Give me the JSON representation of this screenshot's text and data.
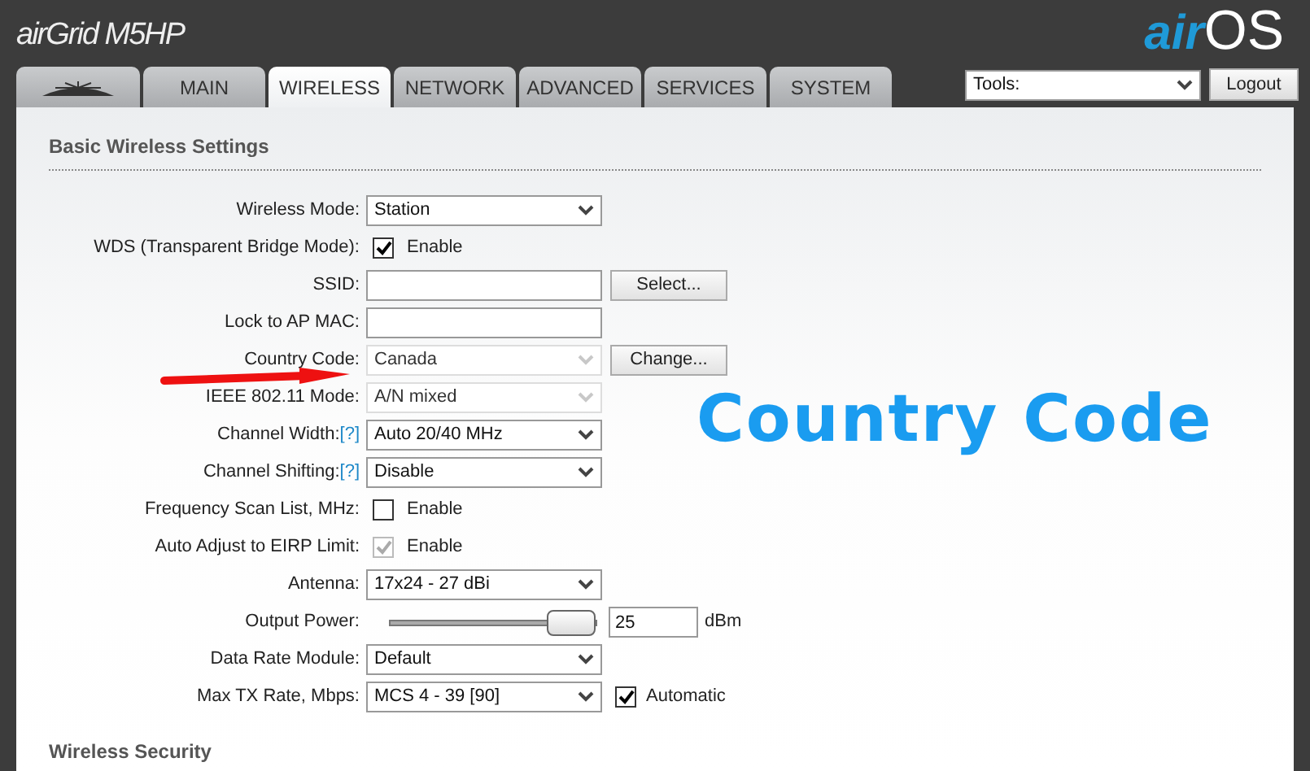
{
  "header": {
    "product": "airGrid M5HP",
    "brand_prefix": "air",
    "brand_suffix": "OS"
  },
  "tabs": [
    {
      "kind": "icon",
      "selected": false
    },
    {
      "label": "MAIN",
      "selected": false
    },
    {
      "label": "WIRELESS",
      "selected": true
    },
    {
      "label": "NETWORK",
      "selected": false
    },
    {
      "label": "ADVANCED",
      "selected": false
    },
    {
      "label": "SERVICES",
      "selected": false
    },
    {
      "label": "SYSTEM",
      "selected": false
    }
  ],
  "tools": {
    "value": "Tools:"
  },
  "logout": "Logout",
  "section_title": "Basic Wireless Settings",
  "rows": [
    {
      "kind": "select",
      "label": "Wireless Mode:",
      "value": "Station",
      "disabled": false
    },
    {
      "kind": "checkbox",
      "label": "WDS (Transparent Bridge Mode):",
      "checked": true,
      "disabled": false,
      "text": "Enable"
    },
    {
      "kind": "text",
      "label": "SSID:",
      "button": "Select..."
    },
    {
      "kind": "text",
      "label": "Lock to AP MAC:"
    },
    {
      "kind": "select",
      "label": "Country Code:",
      "value": "Canada",
      "disabled": true,
      "button": "Change..."
    },
    {
      "kind": "select",
      "label": "IEEE 802.11 Mode:",
      "value": "A/N mixed",
      "disabled": true
    },
    {
      "kind": "select",
      "label": "Channel Width:",
      "help": "[?]",
      "value": "Auto 20/40 MHz",
      "disabled": false
    },
    {
      "kind": "select",
      "label": "Channel Shifting:",
      "help": "[?]",
      "value": "Disable",
      "disabled": false
    },
    {
      "kind": "checkbox",
      "label": "Frequency Scan List, MHz:",
      "checked": false,
      "disabled": false,
      "text": "Enable"
    },
    {
      "kind": "checkbox",
      "label": "Auto Adjust to EIRP Limit:",
      "checked": true,
      "disabled": true,
      "text": "Enable"
    },
    {
      "kind": "select",
      "label": "Antenna:",
      "value": "17x24 - 27 dBi",
      "disabled": false
    },
    {
      "kind": "slider",
      "label": "Output Power:",
      "level": 1,
      "value": "25",
      "unit": "dBm"
    },
    {
      "kind": "select",
      "label": "Data Rate Module:",
      "value": "Default",
      "disabled": false
    },
    {
      "kind": "select",
      "label": "Max TX Rate, Mbps:",
      "value": "MCS 4 - 39 [90]",
      "disabled": false,
      "check": {
        "checked": true,
        "text": "Automatic"
      }
    }
  ],
  "next_section_title": "Wireless Security",
  "annotation": {
    "text": "Country Code"
  }
}
